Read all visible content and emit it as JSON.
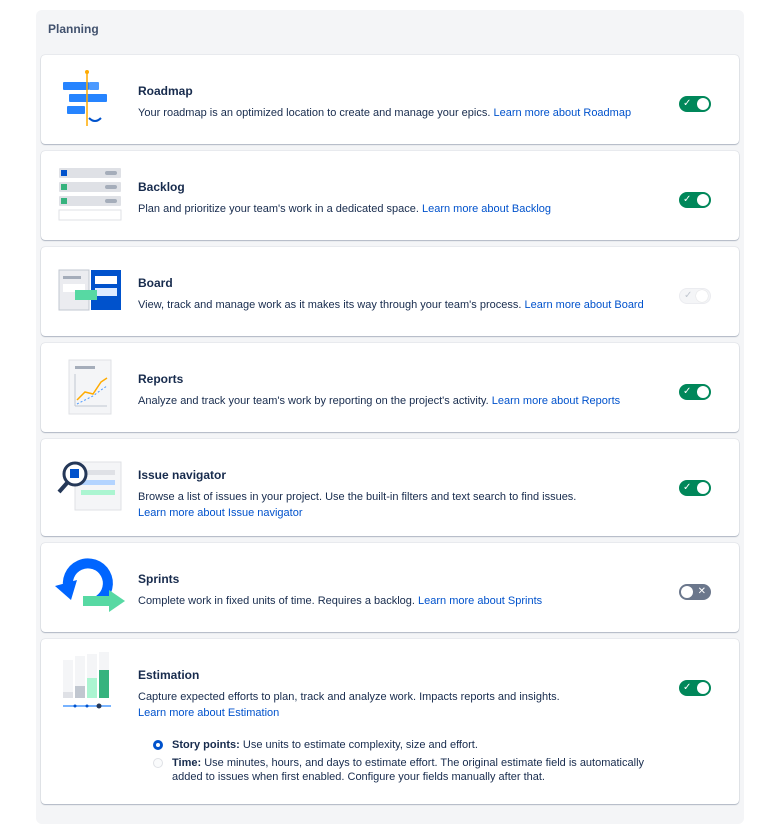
{
  "section": {
    "title": "Planning"
  },
  "features": [
    {
      "title": "Roadmap",
      "description": "Your roadmap is an optimized location to create and manage your epics.",
      "link": "Learn more about Roadmap",
      "state": "on"
    },
    {
      "title": "Backlog",
      "description": "Plan and prioritize your team's work in a dedicated space.",
      "link": "Learn more about Backlog",
      "state": "on"
    },
    {
      "title": "Board",
      "description": "View, track and manage work as it makes its way through your team's process.",
      "link": "Learn more about Board",
      "state": "disabled"
    },
    {
      "title": "Reports",
      "description": "Analyze and track your team's work by reporting on the project's activity.",
      "link": "Learn more about Reports",
      "state": "on"
    },
    {
      "title": "Issue navigator",
      "description": "Browse a list of issues in your project. Use the built-in filters and text search to find issues.",
      "link": "Learn more about Issue navigator",
      "state": "on"
    },
    {
      "title": "Sprints",
      "description": "Complete work in fixed units of time. Requires a backlog.",
      "link": "Learn more about Sprints",
      "state": "off"
    },
    {
      "title": "Estimation",
      "description": "Capture expected efforts to plan, track and analyze work. Impacts reports and insights.",
      "link": "Learn more about Estimation",
      "state": "on"
    }
  ],
  "estimation_options": [
    {
      "label": "Story points:",
      "description": "Use units to estimate complexity, size and effort.",
      "selected": true
    },
    {
      "label": "Time:",
      "description": "Use minutes, hours, and days to estimate effort. The original estimate field is automatically added to issues when first enabled. Configure your fields manually after that.",
      "selected": false
    }
  ],
  "icons": {
    "on": "checkmark-icon",
    "off": "x-icon"
  },
  "colors": {
    "toggle_on": "#00875a",
    "toggle_off": "#6b778c",
    "link": "#0052cc",
    "radio_selected": "#0052cc"
  }
}
